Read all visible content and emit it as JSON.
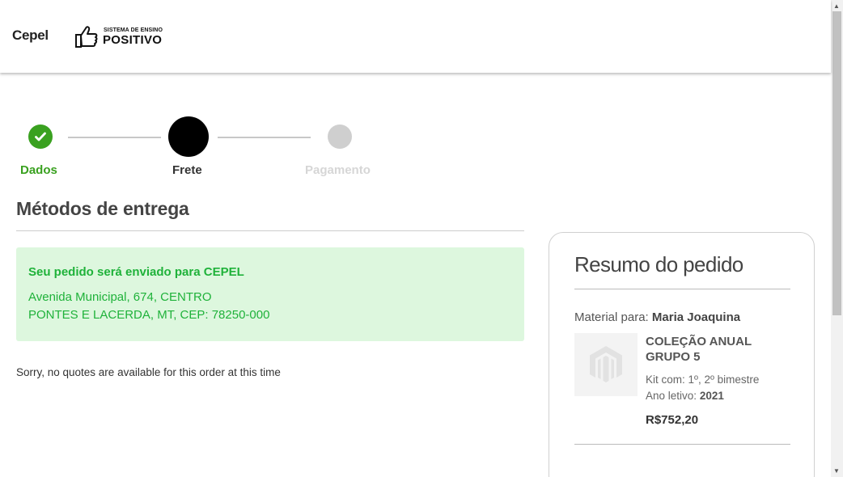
{
  "header": {
    "store_name": "Cepel",
    "logo_line1": "SISTEMA DE ENSINO",
    "logo_line2": "POSITIVO"
  },
  "steps": [
    {
      "label": "Dados",
      "state": "completed",
      "color": "#3aa120"
    },
    {
      "label": "Frete",
      "state": "active",
      "color": "#000000"
    },
    {
      "label": "Pagamento",
      "state": "pending",
      "color": "#cfcfcf"
    }
  ],
  "shipping": {
    "title": "Métodos de entrega",
    "destination_title": "Seu pedido será enviado para CEPEL",
    "address_line1": "Avenida Municipal, 674, CENTRO",
    "address_line2": "PONTES E LACERDA, MT, CEP: 78250-000",
    "no_quotes": "Sorry, no quotes are available for this order at this time"
  },
  "summary": {
    "title": "Resumo do pedido",
    "material_label": "Material para:",
    "student_name": "Maria Joaquina",
    "product_name": "COLEÇÃO ANUAL GRUPO 5",
    "kit": "Kit com: 1º, 2º bimestre",
    "year_label": "Ano letivo:",
    "year": "2021",
    "price": "R$752,20",
    "thumbnail_icon": "magento-placeholder-icon"
  },
  "colors": {
    "success": "#3aa120",
    "notice_bg": "#ddf7de",
    "notice_text": "#1fb23a"
  }
}
